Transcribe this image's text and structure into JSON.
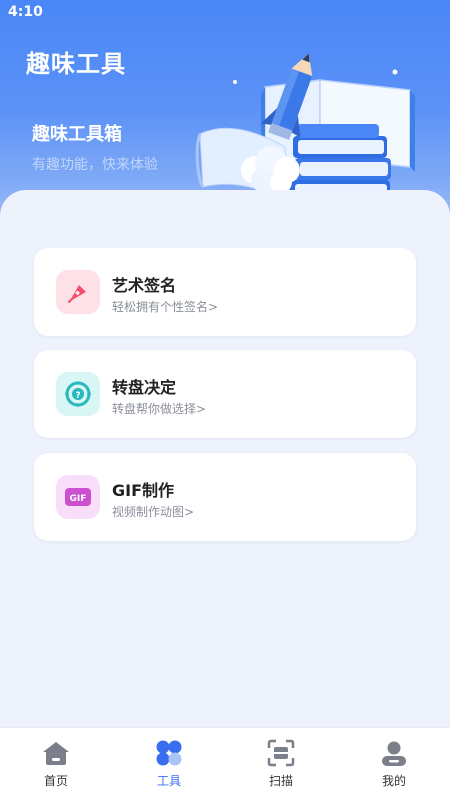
{
  "status_bar": {
    "time": "4:10"
  },
  "header": {
    "title": "趣味工具"
  },
  "hero": {
    "title": "趣味工具箱",
    "subtitle": "有趣功能，快来体验"
  },
  "tools": [
    {
      "title": "艺术签名",
      "subtitle": "轻松拥有个性签名>",
      "icon": "pen-signature-icon",
      "bg": "#fde1e6",
      "fg": "#f0506a"
    },
    {
      "title": "转盘决定",
      "subtitle": "转盘帮你做选择>",
      "icon": "wheel-icon",
      "bg": "#d7f6f4",
      "fg": "#28b8bf"
    },
    {
      "title": "GIF制作",
      "subtitle": "视频制作动图>",
      "icon": "gif-icon",
      "gif_text": "GIF",
      "bg": "#f8def8",
      "fg": "#cc4fd0"
    }
  ],
  "nav": {
    "active": "工具",
    "items": [
      {
        "label": "首页",
        "icon": "home-icon"
      },
      {
        "label": "工具",
        "icon": "tools-grid-icon"
      },
      {
        "label": "扫描",
        "icon": "scan-icon"
      },
      {
        "label": "我的",
        "icon": "profile-icon"
      }
    ]
  },
  "colors": {
    "primary": "#4a86f6",
    "nav_active": "#3a6ef0",
    "nav_inactive": "#7a7f8a"
  }
}
